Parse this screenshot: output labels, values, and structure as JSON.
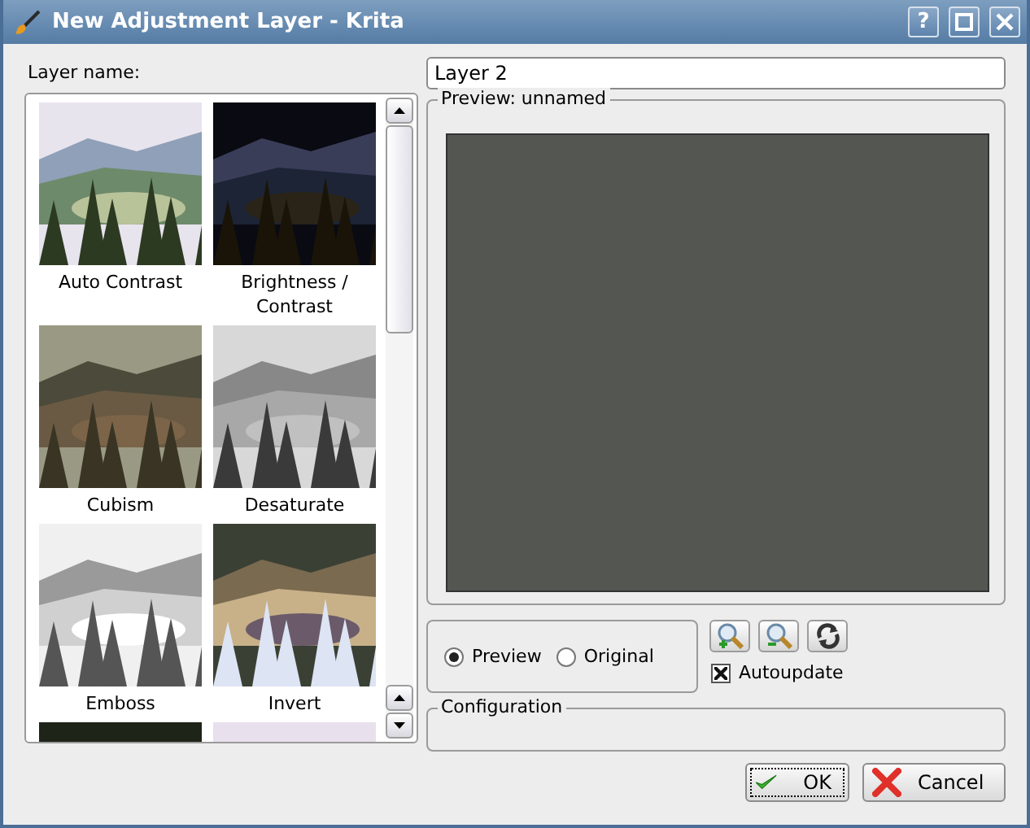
{
  "window": {
    "title": "New Adjustment Layer - Krita",
    "help_button": "?"
  },
  "layer_name": {
    "label": "Layer name:",
    "value": "Layer 2"
  },
  "filters": [
    {
      "label": "Auto Contrast",
      "kind": "picture"
    },
    {
      "label": "Brightness / Contrast",
      "kind": "picture"
    },
    {
      "label": "Cubism",
      "kind": "picture"
    },
    {
      "label": "Desaturate",
      "kind": "picture"
    },
    {
      "label": "Emboss",
      "kind": "picture"
    },
    {
      "label": "Invert",
      "kind": "picture"
    },
    {
      "kind": "picture"
    },
    {
      "kind": "picture"
    }
  ],
  "preview": {
    "title": "Preview: unnamed"
  },
  "view_mode": [
    {
      "label": "Preview",
      "selected": true
    },
    {
      "label": "Original",
      "selected": false
    }
  ],
  "autoupdate": {
    "label": "Autoupdate",
    "checked": true
  },
  "configuration": {
    "title": "Configuration"
  },
  "buttons": [
    {
      "label": "OK",
      "kind": "ok"
    },
    {
      "label": "Cancel",
      "kind": "cancel"
    }
  ]
}
